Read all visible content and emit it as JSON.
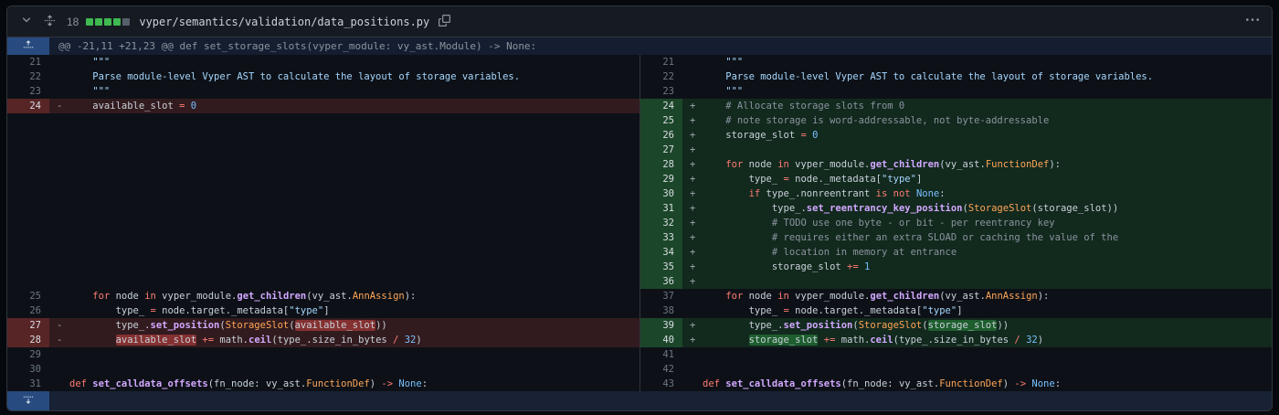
{
  "colors": {
    "addition_green": "#3fb950",
    "deletion_red": "#f85149",
    "accent_blue": "#274b7f",
    "background": "#0d1117",
    "header_background": "#161b22",
    "border": "#30363d"
  },
  "file_header": {
    "changes_count": "18",
    "diffstat": [
      "add",
      "add",
      "add",
      "add",
      "neutral"
    ],
    "path": "vyper/semantics/validation/data_positions.py"
  },
  "hunk": {
    "header": "@@ -21,11 +21,23 @@ def set_storage_slots(vyper_module: vy_ast.Module) -> None:"
  },
  "rows": [
    {
      "l": {
        "n": "21",
        "t": "ctx",
        "k": [
          [
            "doc",
            "    \"\"\""
          ]
        ]
      },
      "r": {
        "n": "21",
        "t": "ctx",
        "k": [
          [
            "doc",
            "    \"\"\""
          ]
        ]
      }
    },
    {
      "l": {
        "n": "22",
        "t": "ctx",
        "k": [
          [
            "doc",
            "    Parse module-level Vyper AST to calculate the layout of storage variables."
          ]
        ]
      },
      "r": {
        "n": "22",
        "t": "ctx",
        "k": [
          [
            "doc",
            "    Parse module-level Vyper AST to calculate the layout of storage variables."
          ]
        ]
      }
    },
    {
      "l": {
        "n": "23",
        "t": "ctx",
        "k": [
          [
            "doc",
            "    \"\"\""
          ]
        ]
      },
      "r": {
        "n": "23",
        "t": "ctx",
        "k": [
          [
            "doc",
            "    \"\"\""
          ]
        ]
      }
    },
    {
      "l": {
        "n": "24",
        "t": "del",
        "k": [
          [
            "pl",
            "    available_slot "
          ],
          [
            "k",
            "="
          ],
          [
            "pl",
            " "
          ],
          [
            "num",
            "0"
          ]
        ]
      },
      "r": {
        "n": "24",
        "t": "add",
        "k": [
          [
            "com",
            "    # Allocate storage slots from 0"
          ]
        ]
      }
    },
    {
      "l": {
        "t": "empty",
        "k": []
      },
      "r": {
        "n": "25",
        "t": "add",
        "k": [
          [
            "com",
            "    # note storage is word-addressable, not byte-addressable"
          ]
        ]
      }
    },
    {
      "l": {
        "t": "empty",
        "k": []
      },
      "r": {
        "n": "26",
        "t": "add",
        "k": [
          [
            "pl",
            "    storage_slot "
          ],
          [
            "k",
            "="
          ],
          [
            "pl",
            " "
          ],
          [
            "num",
            "0"
          ]
        ]
      }
    },
    {
      "l": {
        "t": "empty",
        "k": []
      },
      "r": {
        "n": "27",
        "t": "add",
        "k": []
      }
    },
    {
      "l": {
        "t": "empty",
        "k": []
      },
      "r": {
        "n": "28",
        "t": "add",
        "k": [
          [
            "pl",
            "    "
          ],
          [
            "k",
            "for"
          ],
          [
            "pl",
            " node "
          ],
          [
            "k",
            "in"
          ],
          [
            "pl",
            " vyper_module."
          ],
          [
            "fn",
            "get_children"
          ],
          [
            "pl",
            "(vy_ast."
          ],
          [
            "cls",
            "FunctionDef"
          ],
          [
            "pl",
            "):"
          ]
        ]
      }
    },
    {
      "l": {
        "t": "empty",
        "k": []
      },
      "r": {
        "n": "29",
        "t": "add",
        "k": [
          [
            "pl",
            "        type_ "
          ],
          [
            "k",
            "="
          ],
          [
            "pl",
            " node._metadata["
          ],
          [
            "str",
            "\"type\""
          ],
          [
            "pl",
            "]"
          ]
        ]
      }
    },
    {
      "l": {
        "t": "empty",
        "k": []
      },
      "r": {
        "n": "30",
        "t": "add",
        "k": [
          [
            "pl",
            "        "
          ],
          [
            "k",
            "if"
          ],
          [
            "pl",
            " type_.nonreentrant "
          ],
          [
            "k",
            "is"
          ],
          [
            "pl",
            " "
          ],
          [
            "k",
            "not"
          ],
          [
            "pl",
            " "
          ],
          [
            "num",
            "None"
          ],
          [
            "pl",
            ":"
          ]
        ]
      }
    },
    {
      "l": {
        "t": "empty",
        "k": []
      },
      "r": {
        "n": "31",
        "t": "add",
        "k": [
          [
            "pl",
            "            type_."
          ],
          [
            "fn",
            "set_reentrancy_key_position"
          ],
          [
            "pl",
            "("
          ],
          [
            "cls",
            "StorageSlot"
          ],
          [
            "pl",
            "(storage_slot))"
          ]
        ]
      }
    },
    {
      "l": {
        "t": "empty",
        "k": []
      },
      "r": {
        "n": "32",
        "t": "add",
        "k": [
          [
            "com",
            "            # TODO use one byte - or bit - per reentrancy key"
          ]
        ]
      }
    },
    {
      "l": {
        "t": "empty",
        "k": []
      },
      "r": {
        "n": "33",
        "t": "add",
        "k": [
          [
            "com",
            "            # requires either an extra SLOAD or caching the value of the"
          ]
        ]
      }
    },
    {
      "l": {
        "t": "empty",
        "k": []
      },
      "r": {
        "n": "34",
        "t": "add",
        "k": [
          [
            "com",
            "            # location in memory at entrance"
          ]
        ]
      }
    },
    {
      "l": {
        "t": "empty",
        "k": []
      },
      "r": {
        "n": "35",
        "t": "add",
        "k": [
          [
            "pl",
            "            storage_slot "
          ],
          [
            "k",
            "+="
          ],
          [
            "pl",
            " "
          ],
          [
            "num",
            "1"
          ]
        ]
      }
    },
    {
      "l": {
        "t": "empty",
        "k": []
      },
      "r": {
        "n": "36",
        "t": "add",
        "k": []
      }
    },
    {
      "l": {
        "n": "25",
        "t": "ctx",
        "k": [
          [
            "pl",
            "    "
          ],
          [
            "k",
            "for"
          ],
          [
            "pl",
            " node "
          ],
          [
            "k",
            "in"
          ],
          [
            "pl",
            " vyper_module."
          ],
          [
            "fn",
            "get_children"
          ],
          [
            "pl",
            "(vy_ast."
          ],
          [
            "cls",
            "AnnAssign"
          ],
          [
            "pl",
            "):"
          ]
        ]
      },
      "r": {
        "n": "37",
        "t": "ctx",
        "k": [
          [
            "pl",
            "    "
          ],
          [
            "k",
            "for"
          ],
          [
            "pl",
            " node "
          ],
          [
            "k",
            "in"
          ],
          [
            "pl",
            " vyper_module."
          ],
          [
            "fn",
            "get_children"
          ],
          [
            "pl",
            "(vy_ast."
          ],
          [
            "cls",
            "AnnAssign"
          ],
          [
            "pl",
            "):"
          ]
        ]
      }
    },
    {
      "l": {
        "n": "26",
        "t": "ctx",
        "k": [
          [
            "pl",
            "        type_ "
          ],
          [
            "k",
            "="
          ],
          [
            "pl",
            " node.target._metadata["
          ],
          [
            "str",
            "\"type\""
          ],
          [
            "pl",
            "]"
          ]
        ]
      },
      "r": {
        "n": "38",
        "t": "ctx",
        "k": [
          [
            "pl",
            "        type_ "
          ],
          [
            "k",
            "="
          ],
          [
            "pl",
            " node.target._metadata["
          ],
          [
            "str",
            "\"type\""
          ],
          [
            "pl",
            "]"
          ]
        ]
      }
    },
    {
      "l": {
        "n": "27",
        "t": "del",
        "k": [
          [
            "pl",
            "        type_."
          ],
          [
            "fn",
            "set_position"
          ],
          [
            "pl",
            "("
          ],
          [
            "cls",
            "StorageSlot"
          ],
          [
            "pl",
            "("
          ],
          [
            "delw",
            "available_slot"
          ],
          [
            "pl",
            "))"
          ]
        ]
      },
      "r": {
        "n": "39",
        "t": "add",
        "k": [
          [
            "pl",
            "        type_."
          ],
          [
            "fn",
            "set_position"
          ],
          [
            "pl",
            "("
          ],
          [
            "cls",
            "StorageSlot"
          ],
          [
            "pl",
            "("
          ],
          [
            "addw",
            "storage_slot"
          ],
          [
            "pl",
            "))"
          ]
        ]
      }
    },
    {
      "l": {
        "n": "28",
        "t": "del",
        "k": [
          [
            "pl",
            "        "
          ],
          [
            "delw",
            "available_slot"
          ],
          [
            "pl",
            " "
          ],
          [
            "k",
            "+="
          ],
          [
            "pl",
            " math."
          ],
          [
            "fn",
            "ceil"
          ],
          [
            "pl",
            "(type_.size_in_bytes "
          ],
          [
            "k",
            "/"
          ],
          [
            "pl",
            " "
          ],
          [
            "num",
            "32"
          ],
          [
            "pl",
            ")"
          ]
        ]
      },
      "r": {
        "n": "40",
        "t": "add",
        "k": [
          [
            "pl",
            "        "
          ],
          [
            "addw",
            "storage_slot"
          ],
          [
            "pl",
            " "
          ],
          [
            "k",
            "+="
          ],
          [
            "pl",
            " math."
          ],
          [
            "fn",
            "ceil"
          ],
          [
            "pl",
            "(type_.size_in_bytes "
          ],
          [
            "k",
            "/"
          ],
          [
            "pl",
            " "
          ],
          [
            "num",
            "32"
          ],
          [
            "pl",
            ")"
          ]
        ]
      }
    },
    {
      "l": {
        "n": "29",
        "t": "ctx",
        "k": []
      },
      "r": {
        "n": "41",
        "t": "ctx",
        "k": []
      }
    },
    {
      "l": {
        "n": "30",
        "t": "ctx",
        "k": []
      },
      "r": {
        "n": "42",
        "t": "ctx",
        "k": []
      }
    },
    {
      "l": {
        "n": "31",
        "t": "ctx",
        "k": [
          [
            "k",
            "def"
          ],
          [
            "pl",
            " "
          ],
          [
            "fn",
            "set_calldata_offsets"
          ],
          [
            "pl",
            "(fn_node: vy_ast."
          ],
          [
            "cls",
            "FunctionDef"
          ],
          [
            "pl",
            ") "
          ],
          [
            "k",
            "->"
          ],
          [
            "pl",
            " "
          ],
          [
            "num",
            "None"
          ],
          [
            "pl",
            ":"
          ]
        ]
      },
      "r": {
        "n": "43",
        "t": "ctx",
        "k": [
          [
            "k",
            "def"
          ],
          [
            "pl",
            " "
          ],
          [
            "fn",
            "set_calldata_offsets"
          ],
          [
            "pl",
            "(fn_node: vy_ast."
          ],
          [
            "cls",
            "FunctionDef"
          ],
          [
            "pl",
            ") "
          ],
          [
            "k",
            "->"
          ],
          [
            "pl",
            " "
          ],
          [
            "num",
            "None"
          ],
          [
            "pl",
            ":"
          ]
        ]
      }
    }
  ]
}
